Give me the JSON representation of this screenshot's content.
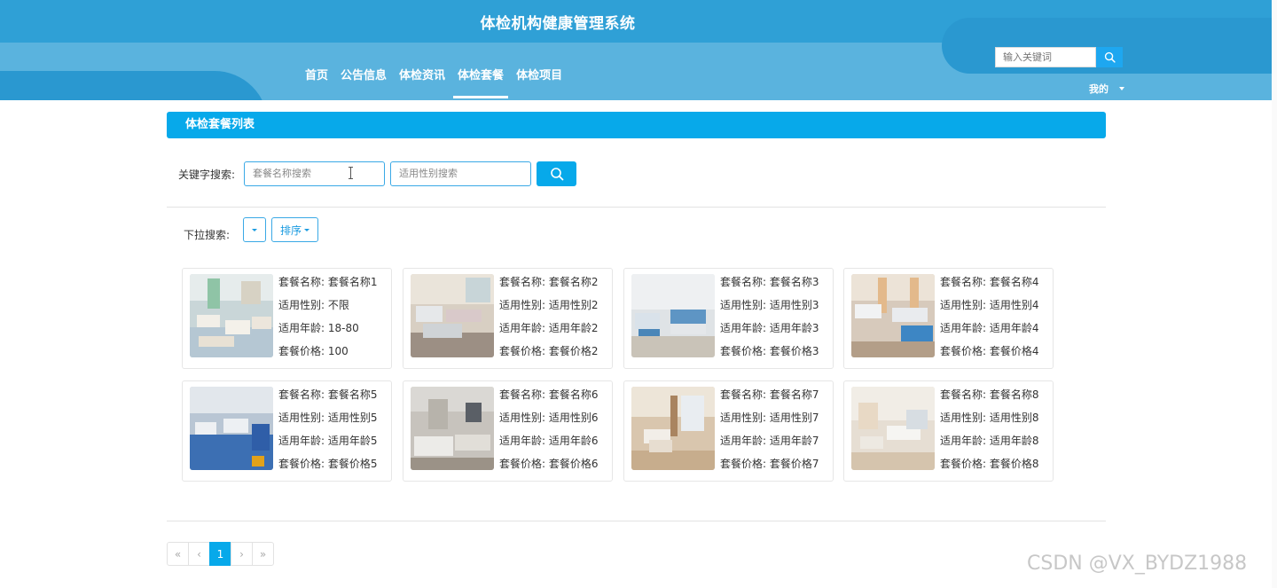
{
  "header": {
    "site_title": "体检机构健康管理系统",
    "nav": [
      {
        "label": "首页"
      },
      {
        "label": "公告信息"
      },
      {
        "label": "体检资讯"
      },
      {
        "label": "体检套餐",
        "active": true
      },
      {
        "label": "体检项目"
      }
    ],
    "search_placeholder": "输入关键词",
    "user_menu_label": "我的"
  },
  "panel": {
    "title": "体检套餐列表"
  },
  "keyword_search": {
    "label": "关键字搜索:",
    "name_placeholder": "套餐名称搜索",
    "gender_placeholder": "适用性别搜索"
  },
  "dropdown_search": {
    "label": "下拉搜索:",
    "sort_label": "排序"
  },
  "field_labels": {
    "name": "套餐名称:",
    "gender": "适用性别:",
    "age": "适用年龄:",
    "price": "套餐价格:"
  },
  "packages": [
    {
      "name": "套餐名称1",
      "gender": "不限",
      "age": "18-80",
      "price": "100"
    },
    {
      "name": "套餐名称2",
      "gender": "适用性别2",
      "age": "适用年龄2",
      "price": "套餐价格2"
    },
    {
      "name": "套餐名称3",
      "gender": "适用性别3",
      "age": "适用年龄3",
      "price": "套餐价格3"
    },
    {
      "name": "套餐名称4",
      "gender": "适用性别4",
      "age": "适用年龄4",
      "price": "套餐价格4"
    },
    {
      "name": "套餐名称5",
      "gender": "适用性别5",
      "age": "适用年龄5",
      "price": "套餐价格5"
    },
    {
      "name": "套餐名称6",
      "gender": "适用性别6",
      "age": "适用年龄6",
      "price": "套餐价格6"
    },
    {
      "name": "套餐名称7",
      "gender": "适用性别7",
      "age": "适用年龄7",
      "price": "套餐价格7"
    },
    {
      "name": "套餐名称8",
      "gender": "适用性别8",
      "age": "适用年龄8",
      "price": "套餐价格8"
    }
  ],
  "pagination": {
    "first": "«",
    "prev": "‹",
    "current": "1",
    "next": "›",
    "last": "»"
  },
  "watermark": "CSDN @VX_BYDZ1988",
  "colors": {
    "header": "#2fa0d6",
    "accent": "#07a9ea"
  },
  "icons": {
    "search": "search-icon",
    "dropdown": "caret-down-icon"
  }
}
